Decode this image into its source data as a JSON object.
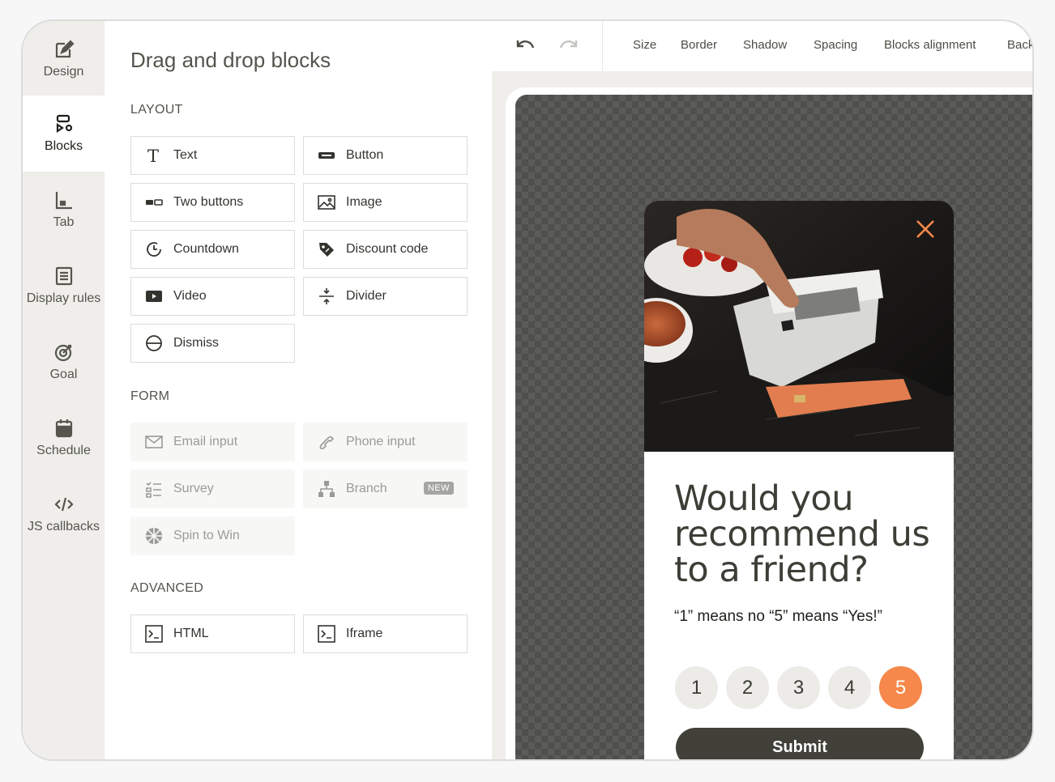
{
  "rail": {
    "items": [
      {
        "label": "Design",
        "icon": "design-icon"
      },
      {
        "label": "Blocks",
        "icon": "blocks-icon"
      },
      {
        "label": "Tab",
        "icon": "tab-icon"
      },
      {
        "label": "Display rules",
        "icon": "display-rules-icon"
      },
      {
        "label": "Goal",
        "icon": "goal-icon"
      },
      {
        "label": "Schedule",
        "icon": "calendar-icon"
      },
      {
        "label": "JS callbacks",
        "icon": "code-icon"
      }
    ],
    "active": "Blocks"
  },
  "panel": {
    "title": "Drag and drop blocks",
    "sections": {
      "layout": "LAYOUT",
      "form": "FORM",
      "advanced": "ADVANCED"
    },
    "layout_blocks": [
      {
        "label": "Text",
        "icon": "text-icon"
      },
      {
        "label": "Button",
        "icon": "button-icon"
      },
      {
        "label": "Two buttons",
        "icon": "two-buttons-icon"
      },
      {
        "label": "Image",
        "icon": "image-icon"
      },
      {
        "label": "Countdown",
        "icon": "countdown-icon"
      },
      {
        "label": "Discount code",
        "icon": "tag-icon"
      },
      {
        "label": "Video",
        "icon": "video-icon"
      },
      {
        "label": "Divider",
        "icon": "divider-icon"
      },
      {
        "label": "Dismiss",
        "icon": "dismiss-icon"
      }
    ],
    "form_blocks": [
      {
        "label": "Email input",
        "icon": "mail-icon"
      },
      {
        "label": "Phone input",
        "icon": "phone-icon"
      },
      {
        "label": "Survey",
        "icon": "survey-icon"
      },
      {
        "label": "Branch",
        "icon": "branch-icon",
        "badge": "NEW"
      },
      {
        "label": "Spin to Win",
        "icon": "wheel-icon"
      }
    ],
    "advanced_blocks": [
      {
        "label": "HTML",
        "icon": "terminal-icon"
      },
      {
        "label": "Iframe",
        "icon": "terminal-icon"
      }
    ]
  },
  "toolbar": {
    "tabs": [
      "Size",
      "Border",
      "Shadow",
      "Spacing",
      "Blocks alignment",
      "Back"
    ]
  },
  "popup": {
    "headline": "Would you recommend us to a friend?",
    "subline": "“1” means no “5” means “Yes!”",
    "ratings": [
      "1",
      "2",
      "3",
      "4",
      "5"
    ],
    "selected_rating": "5",
    "submit_label": "Submit",
    "accent_color": "#f5884a",
    "button_color": "#41413a"
  }
}
